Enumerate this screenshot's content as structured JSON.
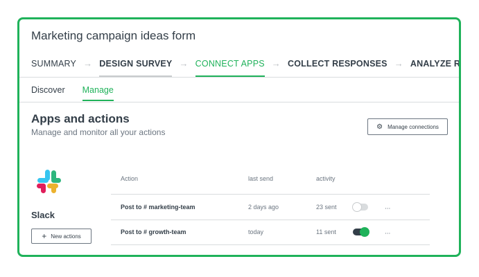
{
  "form": {
    "title": "Marketing campaign ideas form"
  },
  "steps": [
    {
      "label": "SUMMARY"
    },
    {
      "label": "DESIGN SURVEY"
    },
    {
      "label": "CONNECT APPS"
    },
    {
      "label": "COLLECT RESPONSES"
    },
    {
      "label": "ANALYZE RESULTS"
    }
  ],
  "step_arrow": "→",
  "subtabs": [
    {
      "label": "Discover"
    },
    {
      "label": "Manage"
    }
  ],
  "section": {
    "title": "Apps and actions",
    "subtitle": "Manage and monitor all your actions",
    "manage_button": "Manage connections"
  },
  "app": {
    "name": "Slack",
    "new_button": "New actions",
    "logo": "slack-logo"
  },
  "table": {
    "headers": {
      "action": "Action",
      "last_send": "last send",
      "activity": "activity"
    },
    "rows": [
      {
        "action": "Post to # marketing-team",
        "last_send": "2 days ago",
        "activity": "23 sent",
        "enabled": false,
        "more": "..."
      },
      {
        "action": "Post to # growth-team",
        "last_send": "today",
        "activity": "11 sent",
        "enabled": true,
        "more": "..."
      }
    ]
  },
  "colors": {
    "accent": "#1fb25a",
    "text": "#333e48",
    "muted": "#6b7580",
    "border": "#d9dcde"
  },
  "icons": {
    "settings": "gear-icon",
    "add": "plus-icon",
    "more": "more-icon"
  }
}
